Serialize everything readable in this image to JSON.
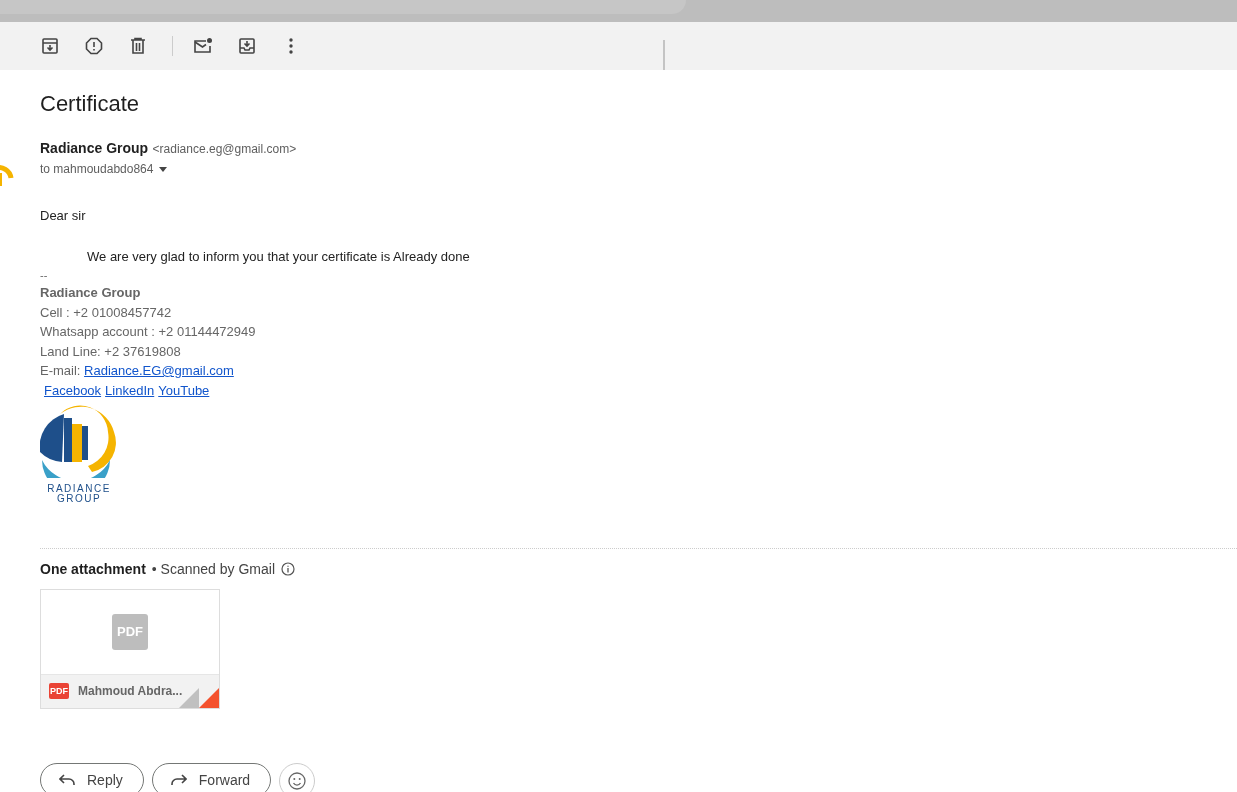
{
  "subject": "Certificate",
  "sender": {
    "name": "Radiance Group",
    "email": "<radiance.eg@gmail.com>",
    "to": "to mahmoudabdo864"
  },
  "body": {
    "greeting": "Dear sir",
    "message": "We are very glad to inform you that your certificate is Already done",
    "separator": "--"
  },
  "signature": {
    "name": "Radiance Group",
    "lines": [
      "Cell : +2 01008457742",
      "Whatsapp account : +2 01144472949",
      "Land Line: +2 37619808"
    ],
    "email_label": "E-mail: ",
    "email_link": "Radiance.EG@gmail.com",
    "links": [
      "Facebook",
      "LinkedIn",
      "YouTube "
    ],
    "logo_lines": [
      "RADIANCE",
      "GROUP"
    ]
  },
  "attachments": {
    "title": "One attachment",
    "scan_note": "• Scanned by Gmail",
    "items": [
      {
        "thumb_label": "PDF",
        "type_label": "PDF",
        "name": "Mahmoud Abdra..."
      }
    ]
  },
  "actions": [
    "Reply",
    "Forward"
  ]
}
